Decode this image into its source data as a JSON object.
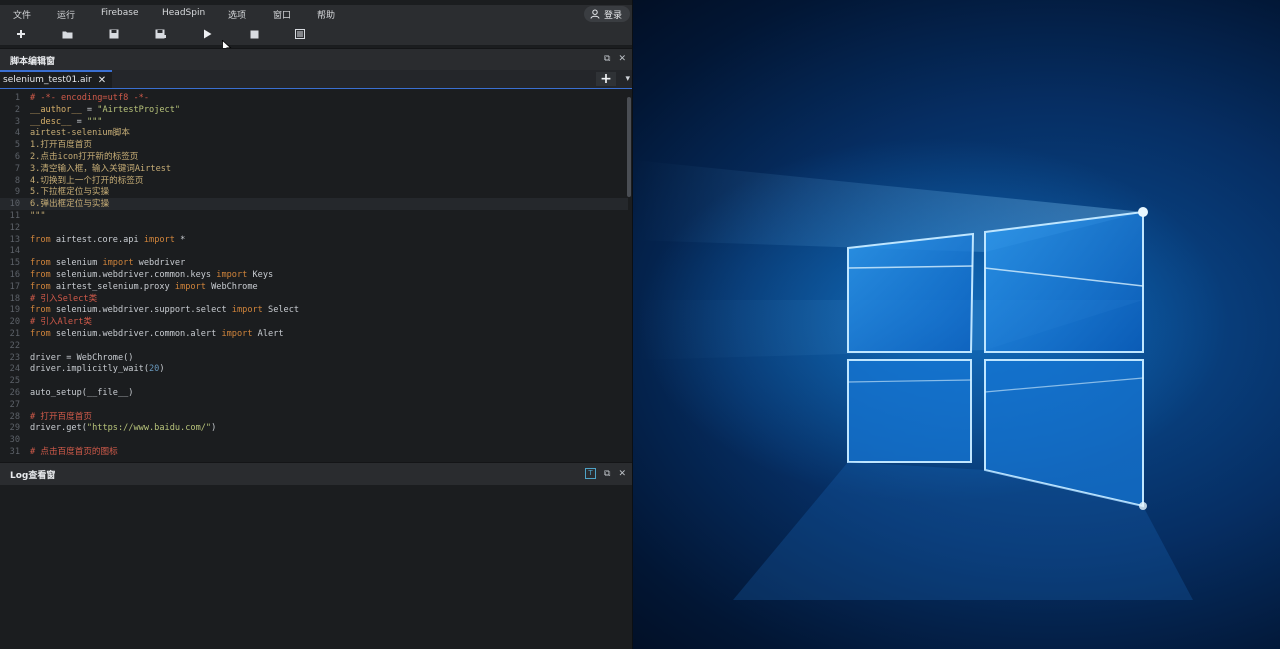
{
  "menubar": {
    "items": [
      "文件",
      "运行",
      "Firebase",
      "HeadSpin",
      "选项",
      "窗口",
      "帮助"
    ],
    "login_label": "登录"
  },
  "toolbar": {
    "buttons": [
      "new-file-icon",
      "open-folder-icon",
      "save-icon",
      "save-all-icon",
      "run-icon",
      "stop-icon",
      "report-icon"
    ]
  },
  "script_panel": {
    "title": "脚本编辑窗",
    "tab_label": "selenium_test01.air"
  },
  "code": [
    {
      "n": "1",
      "t": "# -*- encoding=utf8 -*-"
    },
    {
      "n": "2",
      "t": "__author__ = \"AirtestProject\""
    },
    {
      "n": "3",
      "t": "__desc__ = \"\"\""
    },
    {
      "n": "4",
      "t": "airtest-selenium脚本"
    },
    {
      "n": "5",
      "t": "1.打开百度首页"
    },
    {
      "n": "6",
      "t": "2.点击icon打开新的标签页"
    },
    {
      "n": "7",
      "t": "3.清空输入框，输入关键词Airtest"
    },
    {
      "n": "8",
      "t": "4.切换到上一个打开的标签页"
    },
    {
      "n": "9",
      "t": "5.下拉框定位与实操"
    },
    {
      "n": "10",
      "t": "6.弹出框定位与实操"
    },
    {
      "n": "11",
      "t": "\"\"\""
    },
    {
      "n": "12",
      "t": ""
    },
    {
      "n": "13",
      "t": "from airtest.core.api import *"
    },
    {
      "n": "14",
      "t": ""
    },
    {
      "n": "15",
      "t": "from selenium import webdriver"
    },
    {
      "n": "16",
      "t": "from selenium.webdriver.common.keys import Keys"
    },
    {
      "n": "17",
      "t": "from airtest_selenium.proxy import WebChrome"
    },
    {
      "n": "18",
      "t": "# 引入Select类"
    },
    {
      "n": "19",
      "t": "from selenium.webdriver.support.select import Select"
    },
    {
      "n": "20",
      "t": "# 引入Alert类"
    },
    {
      "n": "21",
      "t": "from selenium.webdriver.common.alert import Alert"
    },
    {
      "n": "22",
      "t": ""
    },
    {
      "n": "23",
      "t": "driver = WebChrome()"
    },
    {
      "n": "24",
      "t": "driver.implicitly_wait(20)"
    },
    {
      "n": "25",
      "t": ""
    },
    {
      "n": "26",
      "t": "auto_setup(__file__)"
    },
    {
      "n": "27",
      "t": ""
    },
    {
      "n": "28",
      "t": "# 打开百度首页"
    },
    {
      "n": "29",
      "t": "driver.get(\"https://www.baidu.com/\")"
    },
    {
      "n": "30",
      "t": ""
    },
    {
      "n": "31",
      "t": "# 点击百度首页的图标"
    }
  ],
  "log_panel": {
    "title": "Log查看窗"
  },
  "colors": {
    "accent": "#3a6fd1",
    "desktop_blue": "#0a4f96"
  }
}
